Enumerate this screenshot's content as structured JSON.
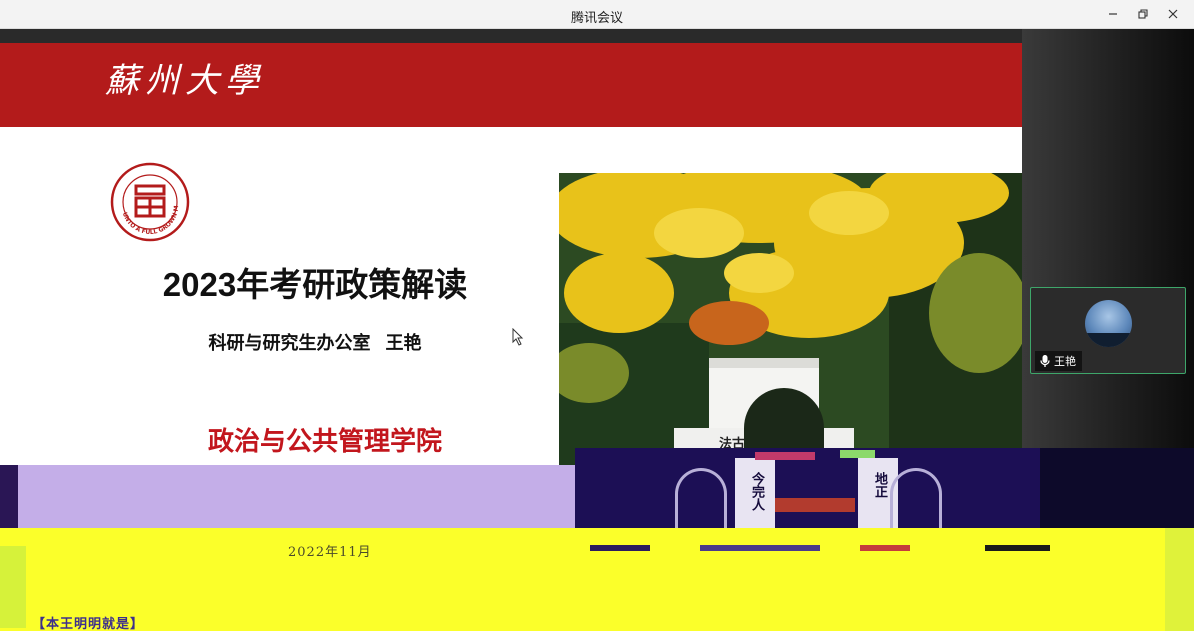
{
  "window": {
    "title": "腾讯会议"
  },
  "slide": {
    "university_logo": "蘇州大學",
    "seal_text": "UNTO A FULL GROWN MAN",
    "title": "2023年考研政策解读",
    "subtitle": "科研与研究生办公室   王艳",
    "school": "政治与公共管理学院",
    "gate_inscription_left": "法古",
    "gate_inscription_left_2": "今完人",
    "gate_inscription_right": "地正"
  },
  "participant": {
    "name": "王艳",
    "mic_icon": "microphone-icon",
    "active_speaker_color": "#3ea66a"
  },
  "glitch": {
    "date_fragment": "2022年11月",
    "bottom_fragment": "【本王明明就是】"
  },
  "colors": {
    "header_red": "#b31b1b",
    "school_red": "#c2161d",
    "glitch_lilac": "#c4aee8",
    "glitch_navy": "#1c0f55",
    "glitch_yellow": "#fbff2a"
  }
}
